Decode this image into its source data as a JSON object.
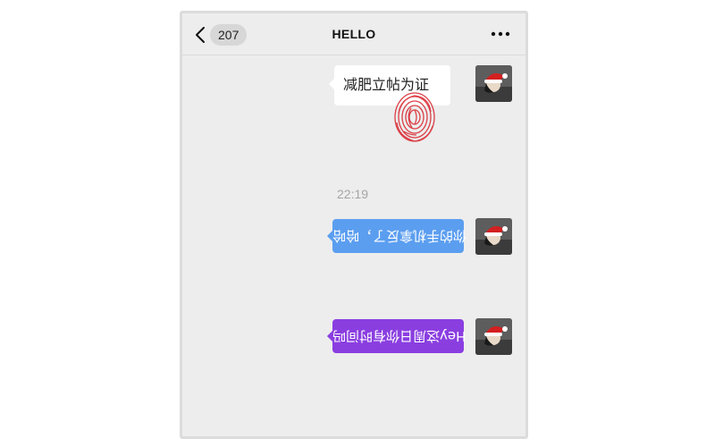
{
  "header": {
    "back_count": "207",
    "title": "HELLO",
    "back_icon": "chevron-left-icon",
    "more_icon": "more-dots-icon"
  },
  "messages": [
    {
      "text": "减肥立帖为证",
      "bubble_color": "#ffffff",
      "stamp": "fingerprint-stamp",
      "rotated": false
    },
    {
      "text": "你的手机拿反了，哈哈",
      "bubble_color": "#5b9ef0",
      "rotated": true
    },
    {
      "text": "Hey这周日你有时间吗",
      "bubble_color": "#8a3ee0",
      "rotated": true
    }
  ],
  "timestamp": "22:19",
  "colors": {
    "background": "#ededed",
    "blue_bubble": "#5b9ef0",
    "purple_bubble": "#8a3ee0",
    "fingerprint": "#d8202a"
  }
}
